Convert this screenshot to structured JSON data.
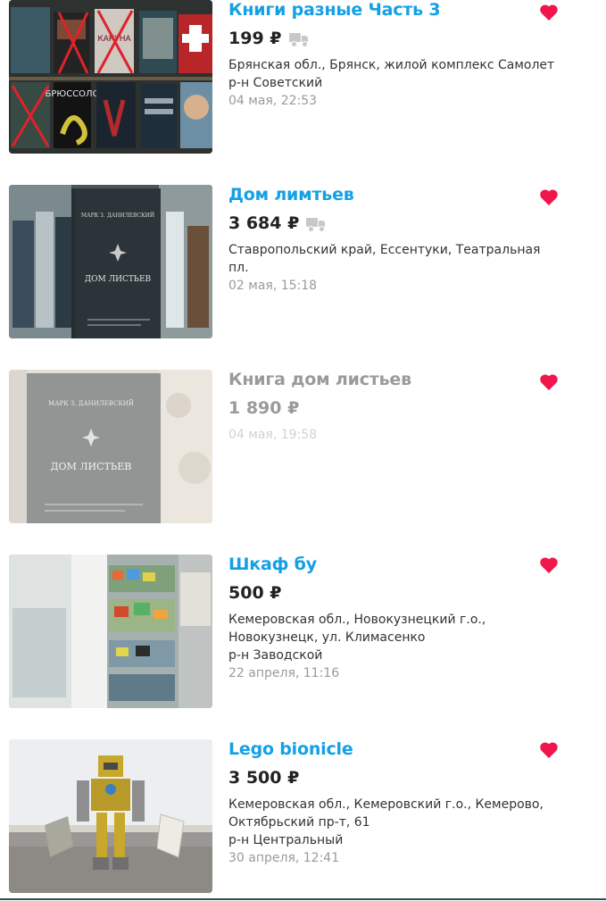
{
  "listings": [
    {
      "title": "Книги разные Часть 3",
      "price": "199 ₽",
      "delivery": true,
      "location": [
        "Брянская обл., Брянск, жилой комплекс Самолет",
        "р-н Советский"
      ],
      "date": "04 мая, 22:53",
      "favorited": true,
      "faded": false,
      "book_labels": [
        "БРЮССОЛО",
        "КАКУНА"
      ],
      "image_icon": "books-photo"
    },
    {
      "title": "Дом лимтьев",
      "price": "3 684 ₽",
      "delivery": true,
      "location": [
        "Ставропольский край, Ессентуки, Театральная",
        "пл."
      ],
      "date": "02 мая, 15:18",
      "favorited": true,
      "faded": false,
      "book_author": "МАРК З. ДАНИЛЕВСКИЙ",
      "book_title": "ДОМ ЛИСТЬЕВ",
      "image_icon": "book-photo"
    },
    {
      "title": "Книга дом листьев",
      "price": "1 890 ₽",
      "delivery": false,
      "location": [],
      "date": "04 мая, 19:58",
      "favorited": true,
      "faded": true,
      "book_author": "МАРК З. ДАНИЛЕВСКИЙ",
      "book_title": "ДОМ ЛИСТЬЕВ",
      "image_icon": "book-photo"
    },
    {
      "title": "Шкаф бу",
      "price": "500 ₽",
      "delivery": false,
      "location": [
        "Кемеровская обл., Новокузнецкий г.о.,",
        "Новокузнецк, ул. Климасенко",
        "р-н Заводской"
      ],
      "date": "22 апреля, 11:16",
      "favorited": true,
      "faded": false,
      "image_icon": "cabinet-photo"
    },
    {
      "title": "Lego bionicle",
      "price": "3 500 ₽",
      "delivery": false,
      "location": [
        "Кемеровская обл., Кемеровский г.о., Кемерово,",
        "Октябрьский пр-т, 61",
        "р-н Центральный"
      ],
      "date": "30 апреля, 12:41",
      "favorited": true,
      "faded": false,
      "image_icon": "lego-photo"
    }
  ],
  "colors": {
    "title": "#14a0e4",
    "price": "#222222",
    "meta": "#333333",
    "date": "#9a9a9a",
    "heart": "#f0164c",
    "truck": "#c8c8c8"
  }
}
